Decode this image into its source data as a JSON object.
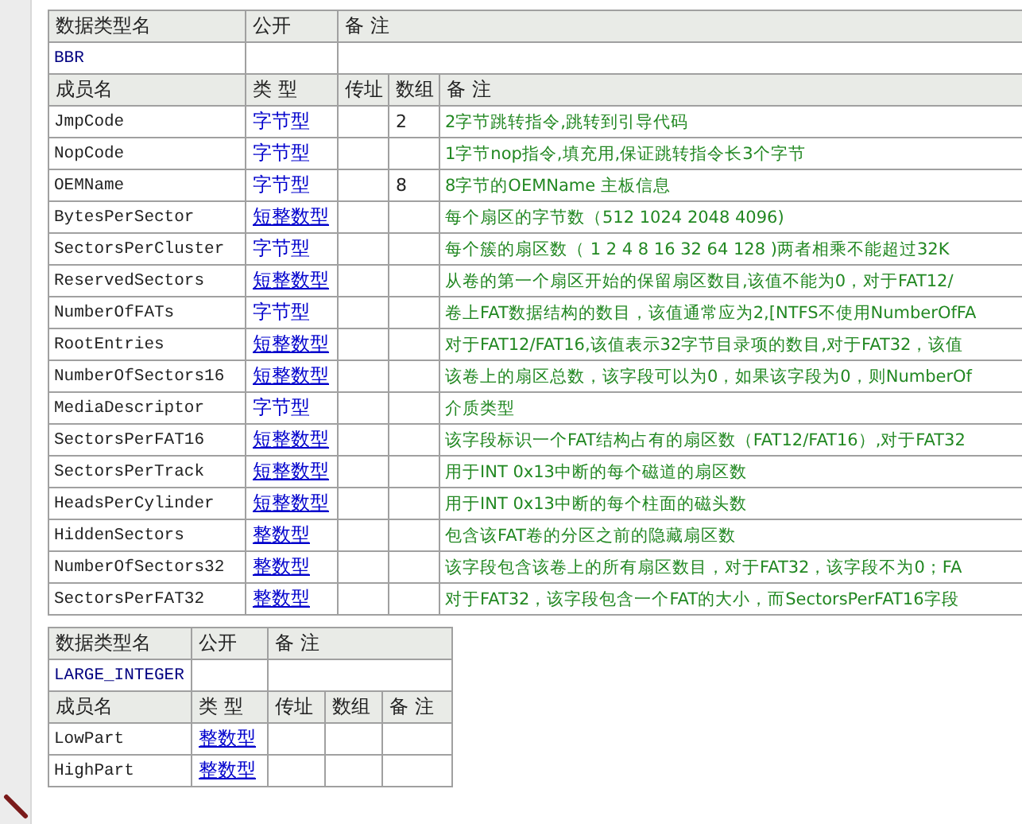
{
  "tables": [
    {
      "header": {
        "type_name_label": "数据类型名",
        "public_label": "公开",
        "remark_label": "备 注"
      },
      "type_name": "BBR",
      "columns": [
        "成员名",
        "类 型",
        "传址",
        "数组",
        "备 注"
      ],
      "members": [
        {
          "name": "JmpCode",
          "type": "字节型",
          "type_underlined": false,
          "array": "2",
          "remark": "2字节跳转指令,跳转到引导代码"
        },
        {
          "name": "NopCode",
          "type": "字节型",
          "type_underlined": false,
          "remark": "1字节nop指令,填充用,保证跳转指令长3个字节"
        },
        {
          "name": "OEMName",
          "type": "字节型",
          "type_underlined": false,
          "array": "8",
          "remark": "8字节的OEMName 主板信息"
        },
        {
          "name": "BytesPerSector",
          "type": "短整数型",
          "type_underlined": true,
          "remark": "每个扇区的字节数（512 1024 2048 4096)"
        },
        {
          "name": "SectorsPerCluster",
          "type": "字节型",
          "type_underlined": false,
          "remark": "每个簇的扇区数（ 1 2 4 8 16 32 64 128 )两者相乘不能超过32K"
        },
        {
          "name": "ReservedSectors",
          "type": "短整数型",
          "type_underlined": true,
          "remark": "从卷的第一个扇区开始的保留扇区数目,该值不能为0，对于FAT12/"
        },
        {
          "name": "NumberOfFATs",
          "type": "字节型",
          "type_underlined": false,
          "remark": "卷上FAT数据结构的数目，该值通常应为2,[NTFS不使用NumberOfFA"
        },
        {
          "name": "RootEntries",
          "type": "短整数型",
          "type_underlined": true,
          "remark": "对于FAT12/FAT16,该值表示32字节目录项的数目,对于FAT32，该值"
        },
        {
          "name": "NumberOfSectors16",
          "type": "短整数型",
          "type_underlined": true,
          "remark": "该卷上的扇区总数，该字段可以为0，如果该字段为0，则NumberOf"
        },
        {
          "name": "MediaDescriptor",
          "type": "字节型",
          "type_underlined": false,
          "remark": "介质类型"
        },
        {
          "name": "SectorsPerFAT16",
          "type": "短整数型",
          "type_underlined": true,
          "remark": "该字段标识一个FAT结构占有的扇区数（FAT12/FAT16）,对于FAT32"
        },
        {
          "name": "SectorsPerTrack",
          "type": "短整数型",
          "type_underlined": true,
          "remark": "用于INT 0x13中断的每个磁道的扇区数"
        },
        {
          "name": "HeadsPerCylinder",
          "type": "短整数型",
          "type_underlined": true,
          "remark": "用于INT 0x13中断的每个柱面的磁头数"
        },
        {
          "name": "HiddenSectors",
          "type": "整数型",
          "type_underlined": true,
          "remark": "包含该FAT卷的分区之前的隐藏扇区数"
        },
        {
          "name": "NumberOfSectors32",
          "type": "整数型",
          "type_underlined": true,
          "remark": "该字段包含该卷上的所有扇区数目，对于FAT32，该字段不为0；FA"
        },
        {
          "name": "SectorsPerFAT32",
          "type": "整数型",
          "type_underlined": true,
          "remark": "对于FAT32，该字段包含一个FAT的大小，而SectorsPerFAT16字段"
        }
      ]
    },
    {
      "header": {
        "type_name_label": "数据类型名",
        "public_label": "公开",
        "remark_label": "备 注"
      },
      "type_name": "LARGE_INTEGER",
      "columns": [
        "成员名",
        "类 型",
        "传址",
        "数组",
        "备 注"
      ],
      "members": [
        {
          "name": "LowPart",
          "type": "整数型",
          "type_underlined": true
        },
        {
          "name": "HighPart",
          "type": "整数型",
          "type_underlined": true
        }
      ]
    }
  ]
}
